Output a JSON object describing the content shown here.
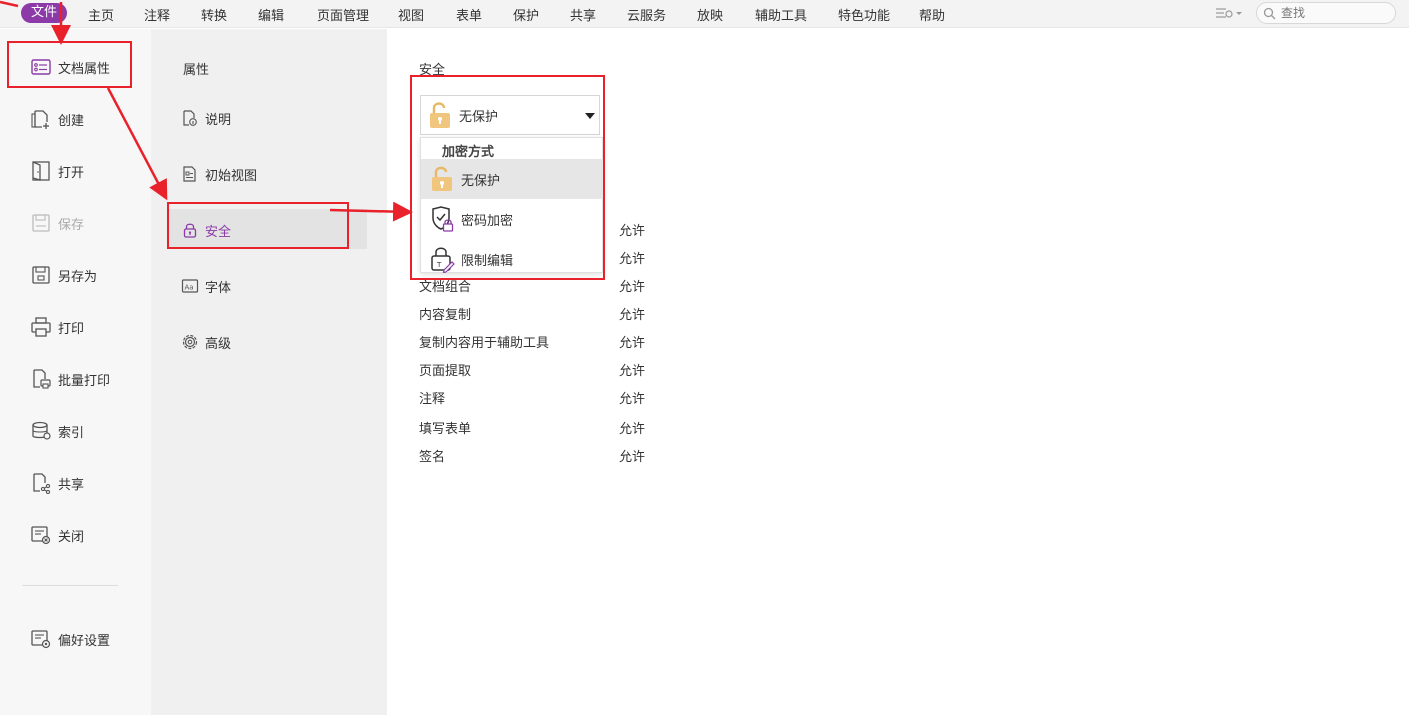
{
  "menubar": {
    "items": [
      {
        "label": "文件",
        "active": true
      },
      {
        "label": "主页"
      },
      {
        "label": "注释"
      },
      {
        "label": "转换"
      },
      {
        "label": "编辑"
      },
      {
        "label": "页面管理"
      },
      {
        "label": "视图"
      },
      {
        "label": "表单"
      },
      {
        "label": "保护"
      },
      {
        "label": "共享"
      },
      {
        "label": "云服务"
      },
      {
        "label": "放映"
      },
      {
        "label": "辅助工具"
      },
      {
        "label": "特色功能"
      },
      {
        "label": "帮助"
      }
    ],
    "search_placeholder": "查找",
    "accent_color": "#8b3aa8"
  },
  "left_nav": {
    "items": [
      {
        "label": "文档属性",
        "icon": "document-properties-icon",
        "selected": true
      },
      {
        "label": "创建",
        "icon": "create-document-icon"
      },
      {
        "label": "打开",
        "icon": "open-book-icon"
      },
      {
        "label": "保存",
        "icon": "save-icon",
        "disabled": true
      },
      {
        "label": "另存为",
        "icon": "save-as-icon"
      },
      {
        "label": "打印",
        "icon": "printer-icon"
      },
      {
        "label": "批量打印",
        "icon": "batch-print-icon"
      },
      {
        "label": "索引",
        "icon": "index-database-icon"
      },
      {
        "label": "共享",
        "icon": "share-icon"
      },
      {
        "label": "关闭",
        "icon": "close-document-icon"
      }
    ],
    "preferences_label": "偏好设置"
  },
  "properties_nav": {
    "title": "属性",
    "items": [
      {
        "label": "说明",
        "icon": "description-icon"
      },
      {
        "label": "初始视图",
        "icon": "initial-view-icon"
      },
      {
        "label": "安全",
        "icon": "lock-icon",
        "selected": true
      },
      {
        "label": "字体",
        "icon": "font-icon"
      },
      {
        "label": "高级",
        "icon": "gear-icon"
      }
    ]
  },
  "security": {
    "section_label": "安全",
    "selected_method": "无保护",
    "dropdown": {
      "header": "加密方式",
      "options": [
        {
          "label": "无保护",
          "icon": "open-padlock-icon",
          "selected": true
        },
        {
          "label": "密码加密",
          "icon": "password-shield-icon"
        },
        {
          "label": "限制编辑",
          "icon": "restrict-edit-icon"
        }
      ]
    },
    "permissions": [
      {
        "name": "",
        "value": "允许"
      },
      {
        "name": "",
        "value": "允许"
      },
      {
        "name": "文档组合",
        "value": "允许"
      },
      {
        "name": "内容复制",
        "value": "允许"
      },
      {
        "name": "复制内容用于辅助工具",
        "value": "允许"
      },
      {
        "name": "页面提取",
        "value": "允许"
      },
      {
        "name": "注释",
        "value": "允许"
      },
      {
        "name": "填写表单",
        "value": "允许"
      },
      {
        "name": "签名",
        "value": "允许"
      }
    ]
  }
}
